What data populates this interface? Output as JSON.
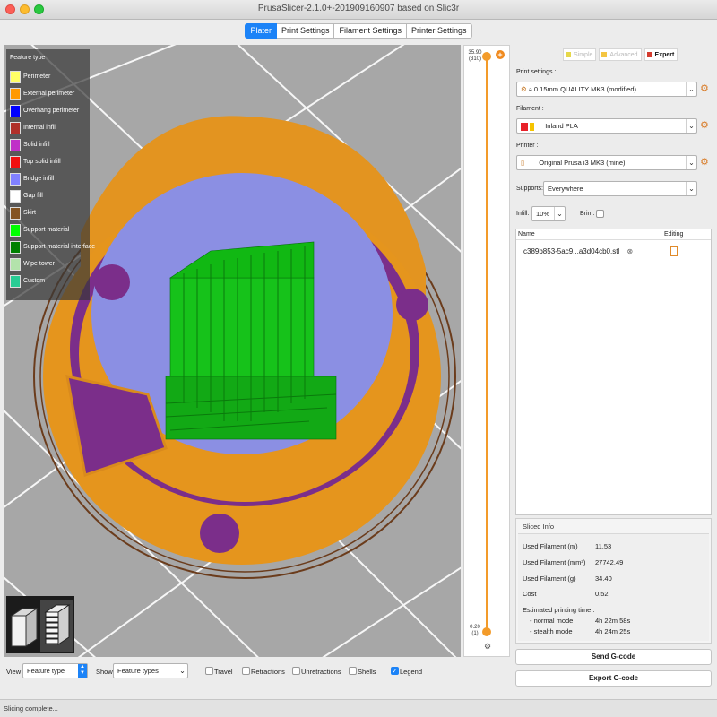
{
  "window": {
    "title": "PrusaSlicer-2.1.0+-201909160907 based on Slic3r"
  },
  "tabs": [
    {
      "label": "Plater"
    },
    {
      "label": "Print Settings"
    },
    {
      "label": "Filament Settings"
    },
    {
      "label": "Printer Settings"
    }
  ],
  "legend": {
    "title": "Feature type",
    "items": [
      {
        "label": "Perimeter",
        "color": "#ffff66"
      },
      {
        "label": "External perimeter",
        "color": "#ff9900"
      },
      {
        "label": "Overhang perimeter",
        "color": "#0000ff"
      },
      {
        "label": "Internal infill",
        "color": "#b03029"
      },
      {
        "label": "Solid infill",
        "color": "#9654cc"
      },
      {
        "label": "Top solid infill",
        "color": "#f01010"
      },
      {
        "label": "Bridge infill",
        "color": "#8080ff"
      },
      {
        "label": "Gap fill",
        "color": "#ffffff"
      },
      {
        "label": "Skirt",
        "color": "#845321"
      },
      {
        "label": "Support material",
        "color": "#00ff00"
      },
      {
        "label": "Support material interface",
        "color": "#008000"
      },
      {
        "label": "Wipe tower",
        "color": "#b3e3ab"
      },
      {
        "label": "Custom",
        "color": "#28cc94"
      }
    ]
  },
  "layer_slider": {
    "top_height": "35.90",
    "top_layer": "(310)",
    "bottom_height": "0.20",
    "bottom_layer": "(1)"
  },
  "sidebar": {
    "modes": [
      {
        "label": "Simple",
        "color": "#e6d84a",
        "active": false
      },
      {
        "label": "Advanced",
        "color": "#f4c542",
        "active": false
      },
      {
        "label": "Expert",
        "color": "#d43b2e",
        "active": true
      }
    ],
    "print_settings_label": "Print settings :",
    "print_settings_value": "0.15mm QUALITY MK3 (modified)",
    "filament_label": "Filament :",
    "filament_value": "Inland PLA",
    "filament_color": "#e8222a",
    "printer_label": "Printer :",
    "printer_value": "Original Prusa i3 MK3 (mine)",
    "supports_label": "Supports:",
    "supports_value": "Everywhere",
    "infill_label": "Infill:",
    "infill_value": "10%",
    "brim_label": "Brim:"
  },
  "object_list": {
    "col_name": "Name",
    "col_editing": "Editing",
    "objects": [
      {
        "name": "c389b853-5ac9...a3d04cb0.stl"
      }
    ]
  },
  "sliced_info": {
    "title": "Sliced Info",
    "rows": [
      {
        "label": "Used Filament (m)",
        "value": "11.53"
      },
      {
        "label": "Used Filament (mm³)",
        "value": "27742.49"
      },
      {
        "label": "Used Filament (g)",
        "value": "34.40"
      },
      {
        "label": "Cost",
        "value": "0.52"
      }
    ],
    "time_title": "Estimated printing time :",
    "normal_label": "- normal mode",
    "normal_value": "4h 22m 58s",
    "stealth_label": "- stealth mode",
    "stealth_value": "4h 24m 25s"
  },
  "buttons": {
    "send_gcode": "Send G-code",
    "export_gcode": "Export G-code"
  },
  "bottom_bar": {
    "view_label": "View",
    "view_value": "Feature type",
    "show_label": "Show",
    "show_value": "Feature types",
    "checks": [
      {
        "label": "Travel",
        "checked": false
      },
      {
        "label": "Retractions",
        "checked": false
      },
      {
        "label": "Unretractions",
        "checked": false
      },
      {
        "label": "Shells",
        "checked": false
      },
      {
        "label": "Legend",
        "checked": true
      }
    ]
  },
  "status": {
    "text": "Slicing complete..."
  }
}
